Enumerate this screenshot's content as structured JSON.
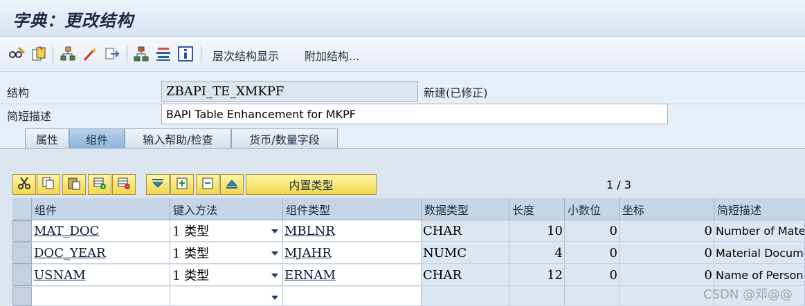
{
  "window": {
    "title": "字典：更改结构"
  },
  "toolbar": {
    "icons": [
      "glasses-pencil-icon",
      "copy-object-icon",
      "hierarchy-icon",
      "magic-wand-icon",
      "export-icon",
      "org-structure-icon",
      "stack-icon",
      "info-icon"
    ],
    "hierarchy_label": "层次结构显示",
    "append_label": "附加结构..."
  },
  "header": {
    "structure_label": "结构",
    "structure_value": "ZBAPI_TE_XMKPF",
    "status_text": "新建(已修正)",
    "desc_label": "简短描述",
    "desc_value": "BAPI Table Enhancement for MKPF"
  },
  "tabs": [
    {
      "label": "属性",
      "active": false
    },
    {
      "label": "组件",
      "active": true
    },
    {
      "label": "输入帮助/检查",
      "active": false
    },
    {
      "label": "货币/数量字段",
      "active": false
    }
  ],
  "table_toolbar": {
    "icons": [
      "cut-icon",
      "copy-icon",
      "paste-icon",
      "insert-row-icon",
      "delete-row-icon",
      "down-icon",
      "insert-icon",
      "delete-icon",
      "up-icon"
    ],
    "builtin_type_label": "内置类型",
    "pager": "1 / 3"
  },
  "table": {
    "columns": [
      "组件",
      "键入方法",
      "组件类型",
      "数据类型",
      "长度",
      "小数位",
      "坐标",
      "简短描述"
    ],
    "rows": [
      {
        "component": "MAT_DOC",
        "method": "1 类型",
        "comp_type": "MBLNR",
        "data_type": "CHAR",
        "length": "10",
        "decimals": "0",
        "coord": "0",
        "desc": "Number of Mate"
      },
      {
        "component": "DOC_YEAR",
        "method": "1 类型",
        "comp_type": "MJAHR",
        "data_type": "NUMC",
        "length": "4",
        "decimals": "0",
        "coord": "0",
        "desc": "Material Docume"
      },
      {
        "component": "USNAM",
        "method": "1 类型",
        "comp_type": "ERNAM",
        "data_type": "CHAR",
        "length": "12",
        "decimals": "0",
        "coord": "0",
        "desc": "Name of Person"
      }
    ]
  },
  "watermark": "CSDN @邓@@"
}
